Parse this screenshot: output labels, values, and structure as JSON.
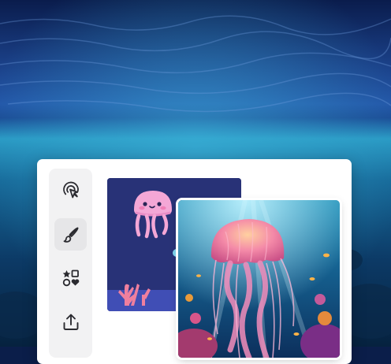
{
  "scene": {
    "backdrop": "underwater-ocean-scene",
    "colors": {
      "ocean_top": "#0a1c4c",
      "ocean_mid": "#1a4f9a",
      "ocean_glow": "#2a9ac4",
      "card_bg": "#ffffff",
      "rail_bg": "#f2f2f3",
      "cartoon_bg": "#283277",
      "jellyfish_pink": "#f08fc8"
    }
  },
  "toolbar": {
    "tools": [
      {
        "icon": "ai-cursor-click-icon",
        "active": false
      },
      {
        "icon": "paintbrush-icon",
        "active": true
      },
      {
        "icon": "elements-shapes-icon",
        "active": false
      },
      {
        "icon": "upload-share-icon",
        "active": false
      }
    ]
  },
  "canvas": {
    "designs": [
      {
        "kind": "cartoon-jellyfish-illustration"
      },
      {
        "kind": "realistic-jellyfish-photo"
      }
    ]
  }
}
